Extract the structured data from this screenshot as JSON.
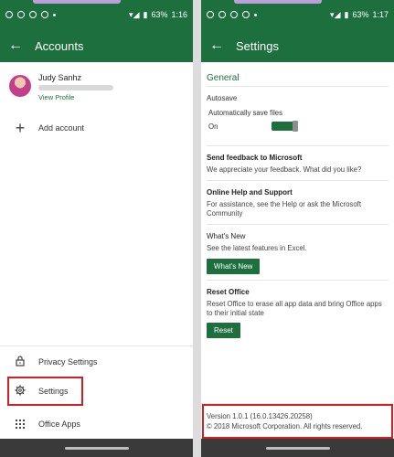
{
  "left": {
    "status": {
      "battery": "63%",
      "time": "1:16"
    },
    "appbar": {
      "title": "Accounts"
    },
    "profile": {
      "name": "Judy Sanhz",
      "view_profile": "View Profile"
    },
    "add_account": "Add account",
    "privacy_settings": "Privacy Settings",
    "settings": "Settings",
    "office_apps": "Office Apps"
  },
  "right": {
    "status": {
      "battery": "63%",
      "time": "1:17"
    },
    "appbar": {
      "title": "Settings"
    },
    "general": "General",
    "autosave": {
      "label": "Autosave",
      "option": "Automatically save files",
      "state": "On"
    },
    "feedback": {
      "title": "Send feedback to Microsoft",
      "desc": "We appreciate your feedback.  What did you like?"
    },
    "help": {
      "title": "Online Help and Support",
      "desc": "For assistance, see the Help or ask the Microsoft Community"
    },
    "whats_new": {
      "title": "What's New",
      "desc": "See the latest features in Excel.",
      "button": "What's New"
    },
    "reset": {
      "title": "Reset Office",
      "desc": "Reset Office to erase all app data and bring Office apps to their initial state",
      "button": "Reset"
    },
    "version": {
      "line1": "Version 1.0.1 (16.0.13426.20258)",
      "line2": "© 2018 Microsoft Corporation. All rights reserved."
    }
  },
  "colors": {
    "accent": "#1d6f3e",
    "highlight": "#d11f26"
  }
}
